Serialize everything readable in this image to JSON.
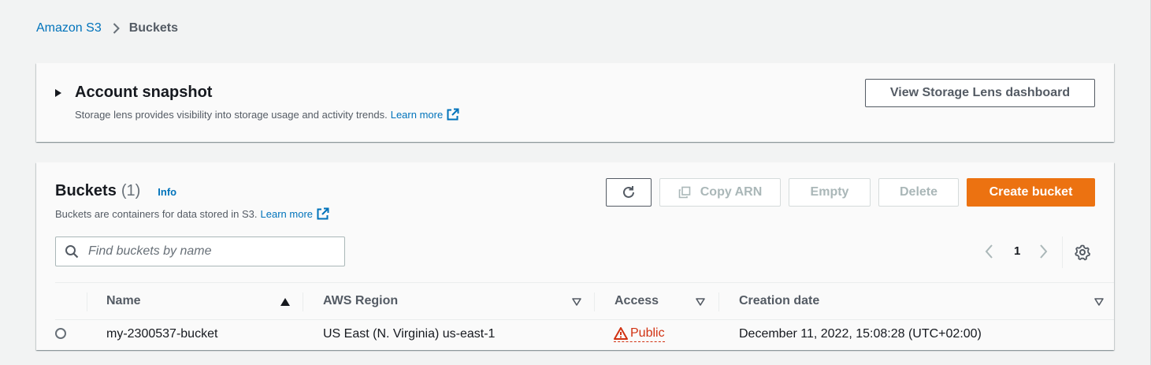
{
  "breadcrumb": {
    "root": "Amazon S3",
    "current": "Buckets"
  },
  "snapshot": {
    "title": "Account snapshot",
    "description": "Storage lens provides visibility into storage usage and activity trends.",
    "learn_more": "Learn more",
    "button": "View Storage Lens dashboard"
  },
  "buckets": {
    "title": "Buckets",
    "count": "(1)",
    "info": "Info",
    "description": "Buckets are containers for data stored in S3.",
    "learn_more": "Learn more",
    "actions": {
      "copy_arn": "Copy ARN",
      "empty": "Empty",
      "delete": "Delete",
      "create": "Create bucket"
    },
    "search_placeholder": "Find buckets by name",
    "page": "1",
    "columns": {
      "name": "Name",
      "region": "AWS Region",
      "access": "Access",
      "created": "Creation date"
    },
    "rows": [
      {
        "name": "my-2300537-bucket",
        "region": "US East (N. Virginia) us-east-1",
        "access": "Public",
        "created": "December 11, 2022, 15:08:28 (UTC+02:00)"
      }
    ]
  },
  "colors": {
    "link": "#0073bb",
    "primary": "#ec7211",
    "danger": "#d13212"
  },
  "icons": [
    "chevron-right-icon",
    "caret-right-icon",
    "external-link-icon",
    "refresh-icon",
    "copy-icon",
    "search-icon",
    "chevron-left-icon",
    "gear-icon",
    "sort-ascending-icon",
    "sort-descending-icon",
    "warning-icon"
  ]
}
